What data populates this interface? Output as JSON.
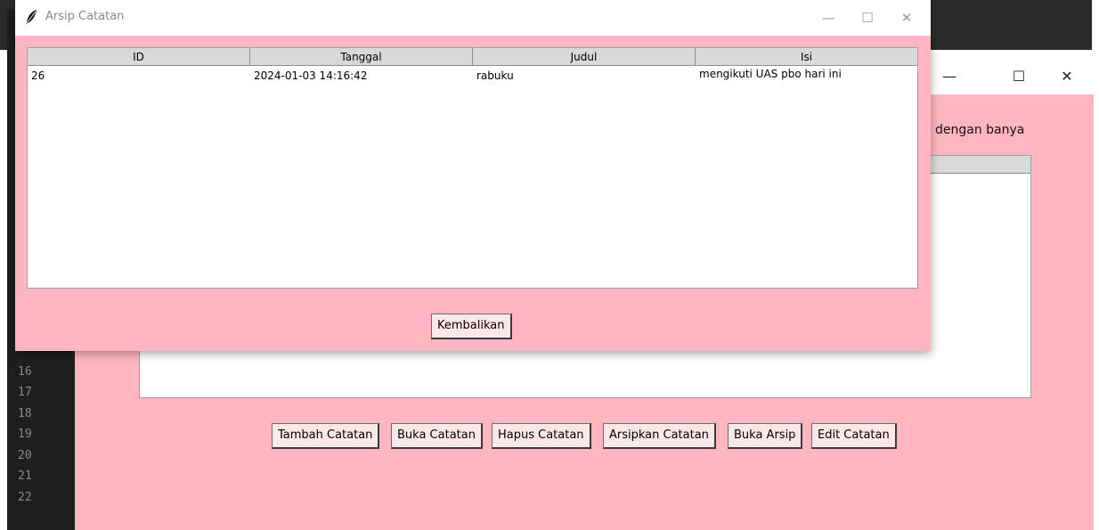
{
  "editor": {
    "line_numbers": [
      "16",
      "17",
      "18",
      "19",
      "20",
      "21",
      "22"
    ]
  },
  "main_window": {
    "controls": {
      "minimize": "—",
      "maximize": "☐",
      "close": "✕"
    },
    "visible_cell_text": "dengan banya",
    "buttons": {
      "tambah": "Tambah Catatan",
      "buka": "Buka Catatan",
      "hapus": "Hapus Catatan",
      "arsipkan": "Arsipkan Catatan",
      "buka_arsip": "Buka Arsip",
      "edit": "Edit Catatan"
    }
  },
  "archive_window": {
    "title": "Arsip Catatan",
    "controls": {
      "minimize": "—",
      "maximize": "☐",
      "close": "✕"
    },
    "table": {
      "columns": [
        "ID",
        "Tanggal",
        "Judul",
        "Isi"
      ],
      "rows": [
        {
          "id": "26",
          "tanggal": "2024-01-03 14:16:42",
          "judul": "rabuku",
          "isi": "mengikuti UAS pbo hari ini"
        }
      ]
    },
    "restore_button": "Kembalikan"
  }
}
